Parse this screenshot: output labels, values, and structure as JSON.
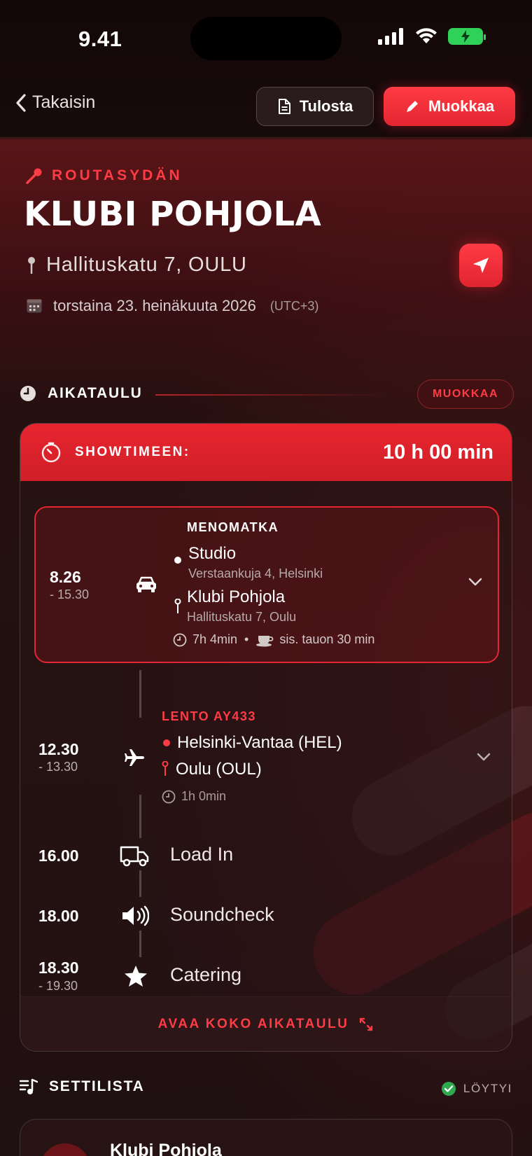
{
  "status": {
    "time": "9.41"
  },
  "nav": {
    "back_label": "Takaisin",
    "print_label": "Tulosta",
    "edit_label": "Muokkaa"
  },
  "header": {
    "artist": "ROUTASYDÄN",
    "venue": "KLUBI POHJOLA",
    "address": "Hallituskatu 7, OULU",
    "date": "torstaina 23. heinäkuuta 2026",
    "timezone": "(UTC+3)"
  },
  "schedule": {
    "title": "AIKATAULU",
    "edit_label": "MUOKKAA",
    "countdown_label": "SHOWTIMEEN:",
    "countdown_value": "10 h 00 min",
    "open_full_label": "AVAA KOKO AIKATAULU",
    "journey": {
      "title": "MENOMATKA",
      "start": "8.26",
      "end": "- 15.30",
      "from_name": "Studio",
      "from_address": "Verstaankuja 4, Helsinki",
      "to_name": "Klubi Pohjola",
      "to_address": "Hallituskatu 7, Oulu",
      "duration": "7h 4min",
      "separator": "•",
      "break_note": "sis. tauon 30 min"
    },
    "flight": {
      "title": "LENTO AY433",
      "start": "12.30",
      "end": "- 13.30",
      "from": "Helsinki-Vantaa (HEL)",
      "to": "Oulu (OUL)",
      "duration": "1h 0min"
    },
    "events": [
      {
        "time": "16.00",
        "label": "Load In",
        "icon": "truck-icon"
      },
      {
        "time": "18.00",
        "label": "Soundcheck",
        "icon": "speaker-icon"
      },
      {
        "time": "18.30",
        "end": "- 19.30",
        "label": "Catering",
        "icon": "star-icon"
      }
    ]
  },
  "setlist": {
    "title": "SETTILISTA",
    "status": "LÖYTYI",
    "item_title": "Klubi Pohjola"
  },
  "colors": {
    "accent": "#e8252f",
    "success": "#2fd158",
    "background": "#1f1011"
  }
}
